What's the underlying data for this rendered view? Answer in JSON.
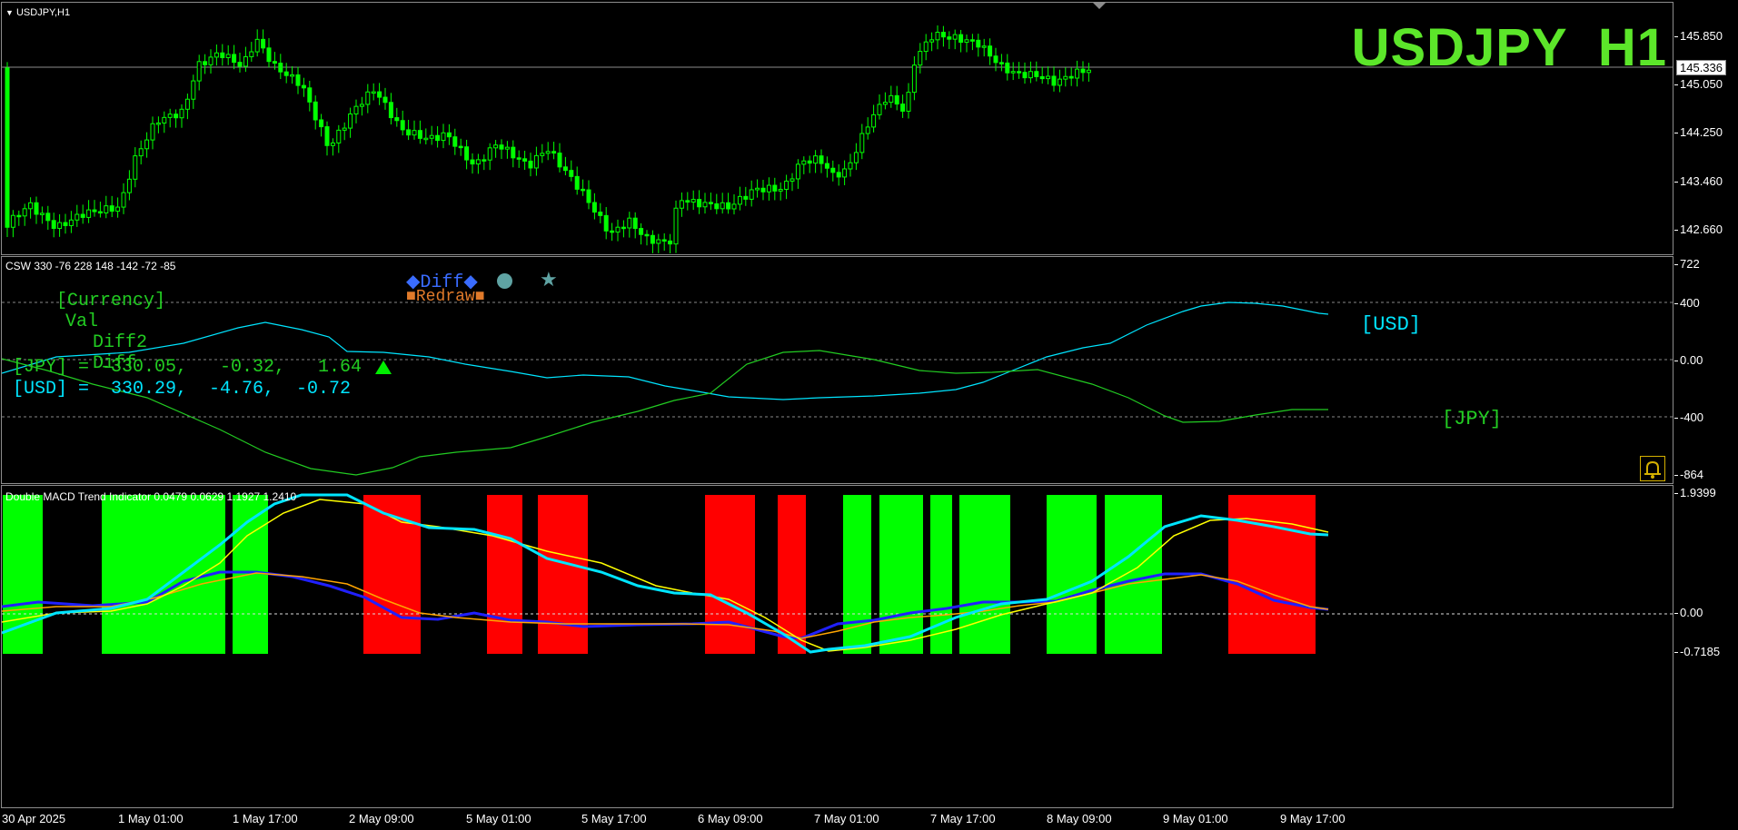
{
  "symbol_label": "USDJPY,H1",
  "watermark": "USDJPY  H1",
  "price_axis": {
    "ticks": [
      "145.850",
      "145.050",
      "144.250",
      "143.460",
      "142.660"
    ],
    "current_price": "145.336"
  },
  "csw": {
    "title": "CSW 330 -76 228 148 -142 -72 -85",
    "header_currency": "[Currency]",
    "header_val": "Val",
    "header_diff2": "Diff2",
    "header_diff": "Diff",
    "button_diff": "Diff",
    "button_redraw": "Redraw",
    "row_jpy": "[JPY] = -330.05,   -0.32,   1.64",
    "row_usd": "[USD] =  330.29,  -4.76,  -0.72",
    "label_usd": "[USD]",
    "label_jpy": "[JPY]",
    "ticks": [
      "722",
      "400",
      "0.00",
      "-400",
      "-864"
    ],
    "colors": {
      "usd": "#00e5ff",
      "jpy": "#22cc22"
    }
  },
  "macd": {
    "title": "Double MACD Trend Indicator 0.0479 0.0629 1.1927 1.2410",
    "ticks": [
      "1.9399",
      "0.00",
      "-0.7185"
    ],
    "colors": {
      "up": "#00ff00",
      "down": "#ff0000",
      "fast": "#00e5ff",
      "signal": "#ffff00",
      "slow": "#2020ff",
      "slow_signal": "#ffa500"
    }
  },
  "time_axis": [
    "30 Apr 2025",
    "1 May 01:00",
    "1 May 17:00",
    "2 May 09:00",
    "5 May 01:00",
    "5 May 17:00",
    "6 May 09:00",
    "7 May 01:00",
    "7 May 17:00",
    "8 May 09:00",
    "9 May 01:00",
    "9 May 17:00"
  ]
}
